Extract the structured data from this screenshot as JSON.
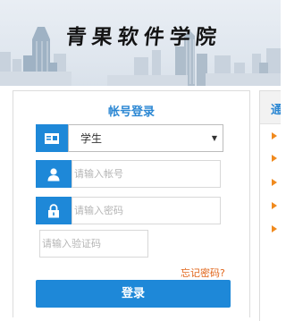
{
  "header": {
    "school_name": "青果软件学院"
  },
  "login": {
    "title": "帐号登录",
    "role_select": {
      "selected": "学生"
    },
    "username": {
      "placeholder": "请输入帐号",
      "icon": "user-icon"
    },
    "password": {
      "placeholder": "请输入密码",
      "icon": "lock-icon"
    },
    "captcha": {
      "placeholder": "请输入验证码"
    },
    "forgot_label": "忘记密码?",
    "submit_label": "登录"
  },
  "notice": {
    "header_text": "通",
    "bullet_icon": "triangle-right-icon"
  },
  "colors": {
    "accent": "#1e88d8",
    "title_blue": "#2b87d3",
    "link_orange": "#e0651a",
    "bullet_orange": "#f08a1e"
  }
}
